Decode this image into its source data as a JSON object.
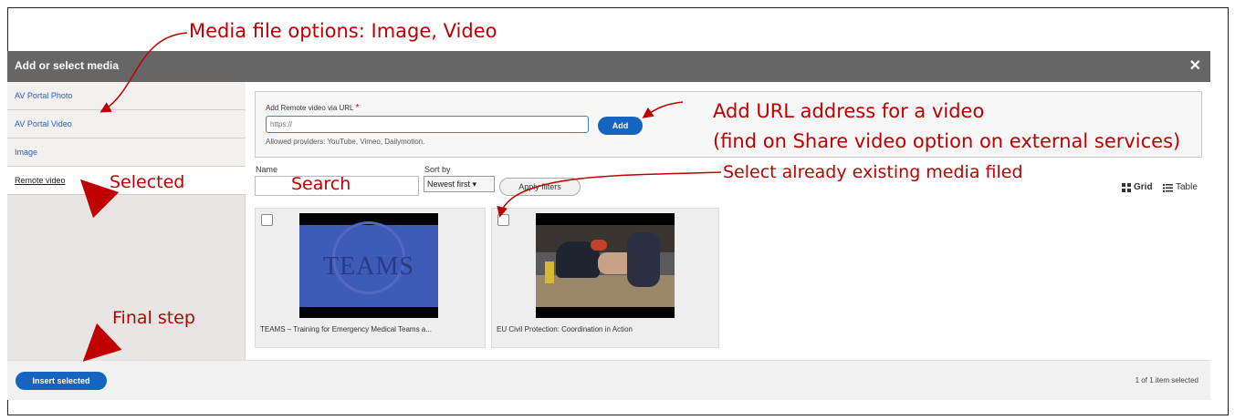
{
  "modal": {
    "title": "Add or select media",
    "close_glyph": "✕"
  },
  "sidebar": {
    "items": [
      {
        "label": "AV Portal Photo"
      },
      {
        "label": "AV Portal Video"
      },
      {
        "label": "Image"
      },
      {
        "label": "Remote video",
        "selected": true
      }
    ]
  },
  "url_form": {
    "label": "Add Remote video via URL",
    "required_mark": "*",
    "placeholder": "https://",
    "add_label": "Add",
    "help": "Allowed providers: YouTube, Vimeo, Dailymotion."
  },
  "filters": {
    "name_label": "Name",
    "sort_label": "Sort by",
    "sort_value": "Newest first ▾",
    "apply_label": "Apply filters"
  },
  "view_toggle": {
    "grid_label": "Grid",
    "table_label": "Table",
    "grid_icon": "grid-icon",
    "table_icon": "list-icon"
  },
  "media_items": [
    {
      "caption": "TEAMS – Training for Emergency Medical Teams a...",
      "thumb_text": "TEAMS",
      "checked": false
    },
    {
      "caption": "EU Civil Protection: Coordination in Action",
      "checked": false
    }
  ],
  "footer": {
    "insert_label": "Insert selected",
    "selection_count": "1 of 1 item selected"
  },
  "annotations": {
    "media_options": "Media file options: Image, Video",
    "add_url_line1": "Add URL address for a video",
    "add_url_line2": "(find on Share video option on external services)",
    "select_existing": "Select already existing media filed",
    "selected": "Selected",
    "search": "Search",
    "final_step": "Final step"
  },
  "colors": {
    "annotation": "#c00000",
    "primary_button": "#1565c0",
    "header_bar": "#666666"
  }
}
